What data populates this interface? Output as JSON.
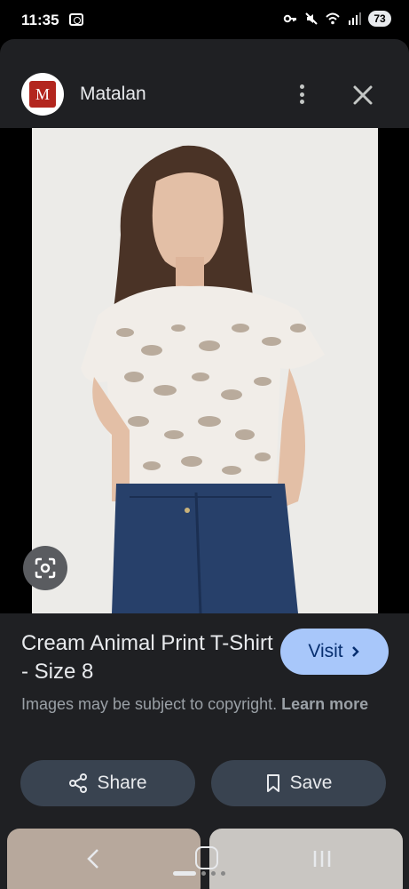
{
  "status_bar": {
    "time": "11:35",
    "battery": "73"
  },
  "header": {
    "site_logo_letter": "M",
    "site_name": "Matalan"
  },
  "result": {
    "title": "Cream Animal Print T-Shirt - Size 8",
    "visit_label": "Visit",
    "copyright_text": "Images may be subject to copyright.",
    "learn_more_label": "Learn more"
  },
  "actions": {
    "share_label": "Share",
    "save_label": "Save"
  },
  "colors": {
    "sheet_bg": "#1f2023",
    "visit_bg": "#a8c7fa",
    "pill_bg": "#394350",
    "logo_red": "#b3261e"
  },
  "icons": [
    "cast-icon",
    "key-icon",
    "mute-icon",
    "wifi-icon",
    "signal-icon",
    "more-vert-icon",
    "close-icon",
    "lens-icon",
    "chevron-right-icon",
    "share-icon",
    "bookmark-icon",
    "back-icon",
    "home-icon",
    "recents-icon"
  ]
}
